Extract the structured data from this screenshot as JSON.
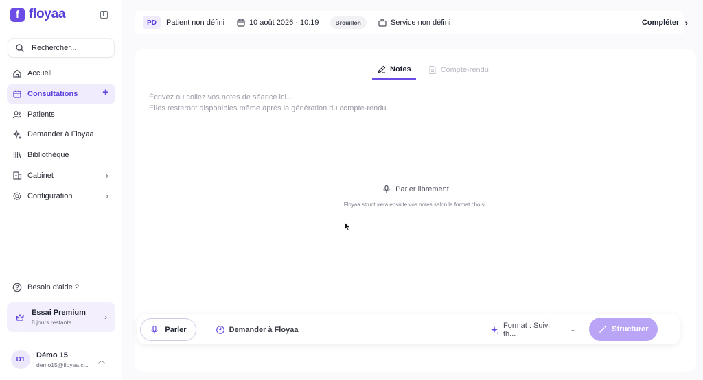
{
  "brand": {
    "name": "floyaa",
    "logo_letter": "f",
    "accent": "#6b4de6"
  },
  "search": {
    "placeholder": "Rechercher..."
  },
  "nav": {
    "items": [
      {
        "label": "Accueil",
        "icon": "home-icon",
        "active": false
      },
      {
        "label": "Consultations",
        "icon": "calendar-icon",
        "active": true,
        "trail": "+"
      },
      {
        "label": "Patients",
        "icon": "users-icon",
        "active": false
      },
      {
        "label": "Demander à Floyaa",
        "icon": "sparkle-icon",
        "active": false
      },
      {
        "label": "Bibliothèque",
        "icon": "library-icon",
        "active": false
      },
      {
        "label": "Cabinet",
        "icon": "building-icon",
        "active": false,
        "trail": "›"
      },
      {
        "label": "Configuration",
        "icon": "gear-icon",
        "active": false,
        "trail": "›"
      }
    ]
  },
  "help": {
    "label": "Besoin d'aide ?"
  },
  "premium": {
    "title": "Essai Premium",
    "subtitle": "8 jours restants"
  },
  "user": {
    "initials": "D1",
    "name": "Démo 15",
    "email": "demo15@floyaa.c..."
  },
  "topbar": {
    "patient_initials": "PD",
    "patient": "Patient non défini",
    "date": "10 août 2026 · 10:19",
    "status": "Brouillon",
    "service": "Service non défini",
    "complete_label": "Compléter"
  },
  "tabs": [
    {
      "label": "Notes",
      "active": true
    },
    {
      "label": "Compte-rendu",
      "active": false
    }
  ],
  "notes": {
    "placeholder": "Écrivez ou collez vos notes de séance ici...\nElles resteront disponibles même après la génération du compte-rendu."
  },
  "speak_hint": {
    "title": "Parler librement",
    "subtitle": "Floyaa structurera ensuite vos notes selon le format choisi."
  },
  "actions": {
    "parler": "Parler",
    "ask": "Demander à Floyaa",
    "format": "Format : Suivi th...",
    "structure": "Structurer"
  }
}
